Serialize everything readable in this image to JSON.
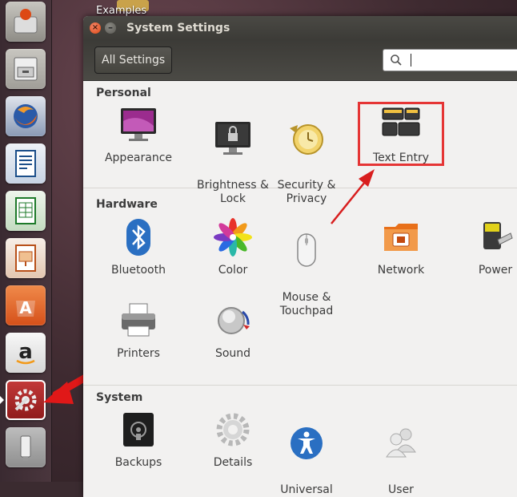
{
  "desktop": {
    "label": "Examples"
  },
  "window": {
    "title": "System Settings"
  },
  "toolbar": {
    "all_settings_label": "All Settings",
    "search_value": "",
    "search_placeholder": ""
  },
  "sections": {
    "personal": {
      "title": "Personal",
      "items": [
        {
          "label": "Appearance"
        },
        {
          "label": "Brightness &\nLock"
        },
        {
          "label": "Security &\nPrivacy"
        },
        {
          "label": "Text Entry"
        }
      ]
    },
    "hardware": {
      "title": "Hardware",
      "items": [
        {
          "label": "Bluetooth"
        },
        {
          "label": "Color"
        },
        {
          "label": "Mouse &\nTouchpad"
        },
        {
          "label": "Network"
        },
        {
          "label": "Power"
        },
        {
          "label": "Printers"
        },
        {
          "label": "Sound"
        }
      ]
    },
    "system": {
      "title": "System",
      "items": [
        {
          "label": "Backups"
        },
        {
          "label": "Details"
        },
        {
          "label": "Universal\nAccess"
        },
        {
          "label": "User\nAccounts"
        }
      ]
    }
  },
  "launcher": {
    "items": [
      {
        "icon": "ubuntu-software-icon"
      },
      {
        "icon": "files-icon"
      },
      {
        "icon": "firefox-icon"
      },
      {
        "icon": "writer-icon"
      },
      {
        "icon": "calc-icon"
      },
      {
        "icon": "impress-icon"
      },
      {
        "icon": "software-center-icon"
      },
      {
        "icon": "amazon-icon"
      },
      {
        "icon": "system-settings-icon"
      },
      {
        "icon": "usb-drive-icon"
      }
    ]
  },
  "colors": {
    "highlight": "#e53535",
    "accent": "#dd4814",
    "titlebar": "#3c3b37",
    "panel": "#f2f1f0"
  }
}
